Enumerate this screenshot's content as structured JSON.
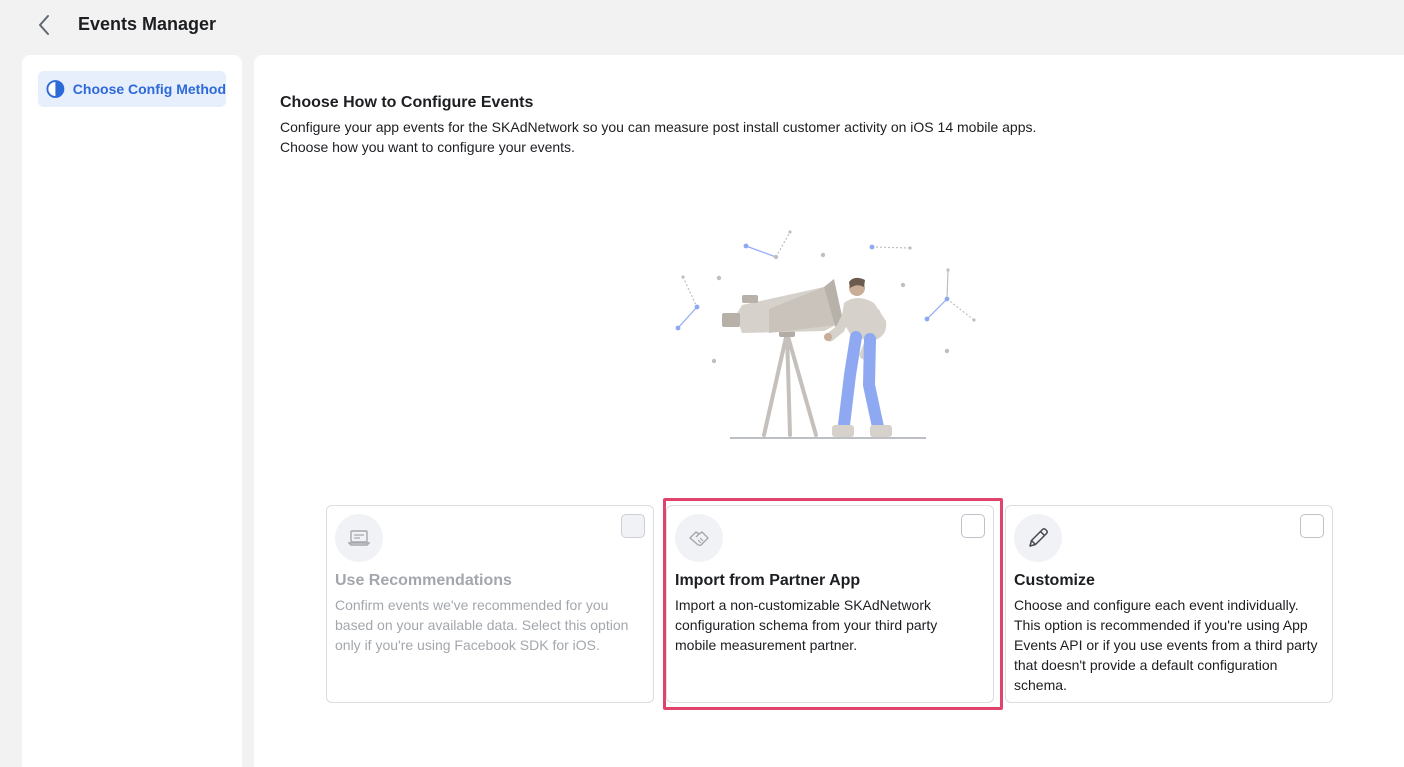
{
  "header": {
    "title": "Events Manager",
    "back_icon": "chevron-left-icon"
  },
  "sidebar": {
    "items": [
      {
        "label": "Choose Config Method",
        "icon": "half-circle-icon",
        "active": true
      }
    ]
  },
  "main": {
    "title": "Choose How to Configure Events",
    "description_line1": "Configure your app events for the SKAdNetwork so you can measure post install customer activity on iOS 14 mobile apps.",
    "description_line2": "Choose how you want to configure your events.",
    "illustration": "person-looking-through-telescope"
  },
  "options": [
    {
      "title": "Use Recommendations",
      "description": "Confirm events we've recommended for you based on your available data. Select this option only if you're using Facebook SDK for iOS.",
      "icon": "laptop-icon",
      "enabled": false,
      "checked": false
    },
    {
      "title": "Import from Partner App",
      "description": "Import a non-customizable SKAdNetwork configuration schema from your third party mobile measurement partner.",
      "icon": "handshake-icon",
      "enabled": true,
      "checked": false,
      "highlighted": true
    },
    {
      "title": "Customize",
      "description": "Choose and configure each event individually. This option is recommended if you're using App Events API or if you use events from a third party that doesn't provide a default configuration schema.",
      "icon": "pencil-icon",
      "enabled": true,
      "checked": false
    }
  ],
  "colors": {
    "accent": "#2d6ad9",
    "highlight": "#e0446d",
    "illustration_blue": "#8fa8f2"
  }
}
